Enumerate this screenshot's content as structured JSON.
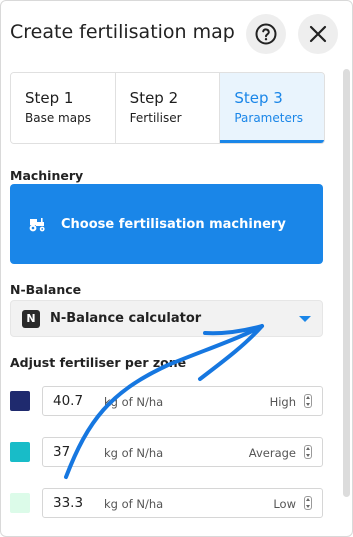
{
  "header": {
    "title": "Create fertilisation map",
    "help_icon": "question-circle-icon",
    "close_icon": "close-icon"
  },
  "tabs": [
    {
      "step": "Step 1",
      "label": "Base maps",
      "active": false
    },
    {
      "step": "Step 2",
      "label": "Fertiliser",
      "active": false
    },
    {
      "step": "Step 3",
      "label": "Parameters",
      "active": true
    }
  ],
  "machinery": {
    "section_label": "Machinery",
    "button_label": "Choose fertilisation machinery",
    "icon": "tractor-icon"
  },
  "n_balance": {
    "section_label": "N-Balance",
    "badge": "N",
    "selected": "N-Balance calculator"
  },
  "zones": {
    "section_label": "Adjust fertiliser per zone",
    "items": [
      {
        "value": "40.7",
        "unit": "kg of N/ha",
        "level": "High",
        "color": "#1f2a6e"
      },
      {
        "value": "37",
        "unit": "kg of N/ha",
        "level": "Average",
        "color": "#18bcc8"
      },
      {
        "value": "33.3",
        "unit": "kg of N/ha",
        "level": "Low",
        "color": "#dcfbe9"
      }
    ]
  },
  "colors": {
    "accent": "#1a86e8",
    "active_tab_bg": "#e9f4fd"
  }
}
